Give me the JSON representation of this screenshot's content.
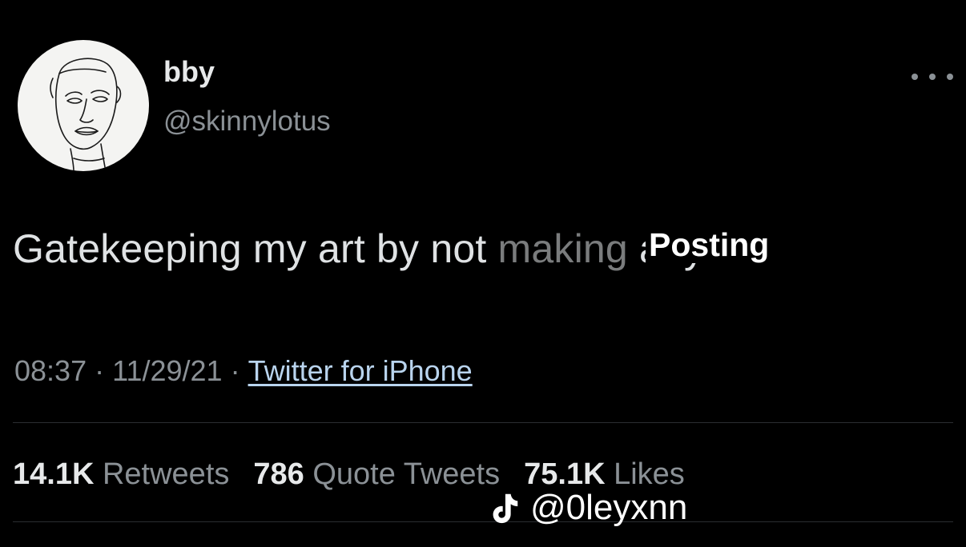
{
  "tweet": {
    "display_name": "bby",
    "handle": "@skinnylotus",
    "text_before": "Gatekeeping my art by not ",
    "text_ghost": "making",
    "text_after": " any",
    "overlay_word": "Posting",
    "time": "08:37",
    "date": "11/29/21",
    "separator": "·",
    "source": "Twitter for iPhone"
  },
  "stats": {
    "retweets_count": "14.1K",
    "retweets_label": "Retweets",
    "quotes_count": "786",
    "quotes_label": "Quote Tweets",
    "likes_count": "75.1K",
    "likes_label": "Likes"
  },
  "watermark": {
    "icon": "tiktok-icon",
    "handle": "@0leyxnn"
  },
  "colors": {
    "background": "#000000",
    "primary_text": "#e7e9ea",
    "secondary_text": "#8b9196",
    "link": "#b9d4ee",
    "divider": "#2b2e31"
  },
  "icons": {
    "more": "more-options-icon",
    "avatar": "line-drawing-face-avatar"
  }
}
